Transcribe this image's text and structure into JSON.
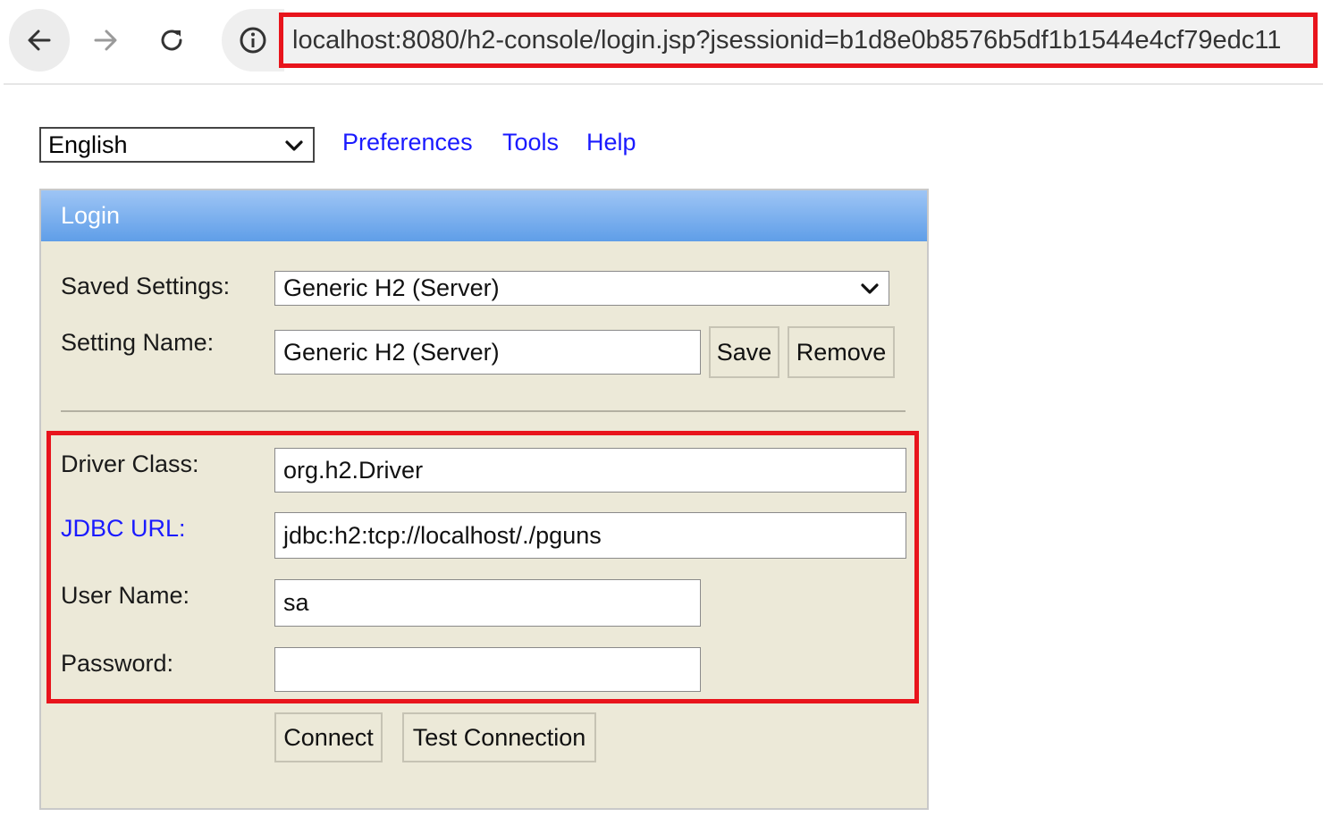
{
  "browser": {
    "url": "localhost:8080/h2-console/login.jsp?jsessionid=b1d8e0b8576b5df1b1544e4cf79edc11",
    "icons": {
      "back": "arrow-left-icon",
      "forward": "arrow-right-icon",
      "reload": "reload-icon",
      "info": "info-icon"
    },
    "highlight_color": "#e8141c"
  },
  "topbar": {
    "language": "English",
    "links": {
      "preferences": "Preferences",
      "tools": "Tools",
      "help": "Help"
    },
    "link_color": "#1a1aff"
  },
  "login": {
    "title": "Login",
    "header_color": "#6fa8ec",
    "panel_color": "#ece9d8",
    "saved_settings_label": "Saved Settings:",
    "saved_settings_value": "Generic H2 (Server)",
    "setting_name_label": "Setting Name:",
    "setting_name_value": "Generic H2 (Server)",
    "save_button": "Save",
    "remove_button": "Remove",
    "driver_class_label": "Driver Class:",
    "driver_class_value": "org.h2.Driver",
    "jdbc_url_label": "JDBC URL:",
    "jdbc_url_value": "jdbc:h2:tcp://localhost/./pguns",
    "user_name_label": "User Name:",
    "user_name_value": "sa",
    "password_label": "Password:",
    "password_value": "",
    "connect_button": "Connect",
    "test_connection_button": "Test Connection"
  }
}
